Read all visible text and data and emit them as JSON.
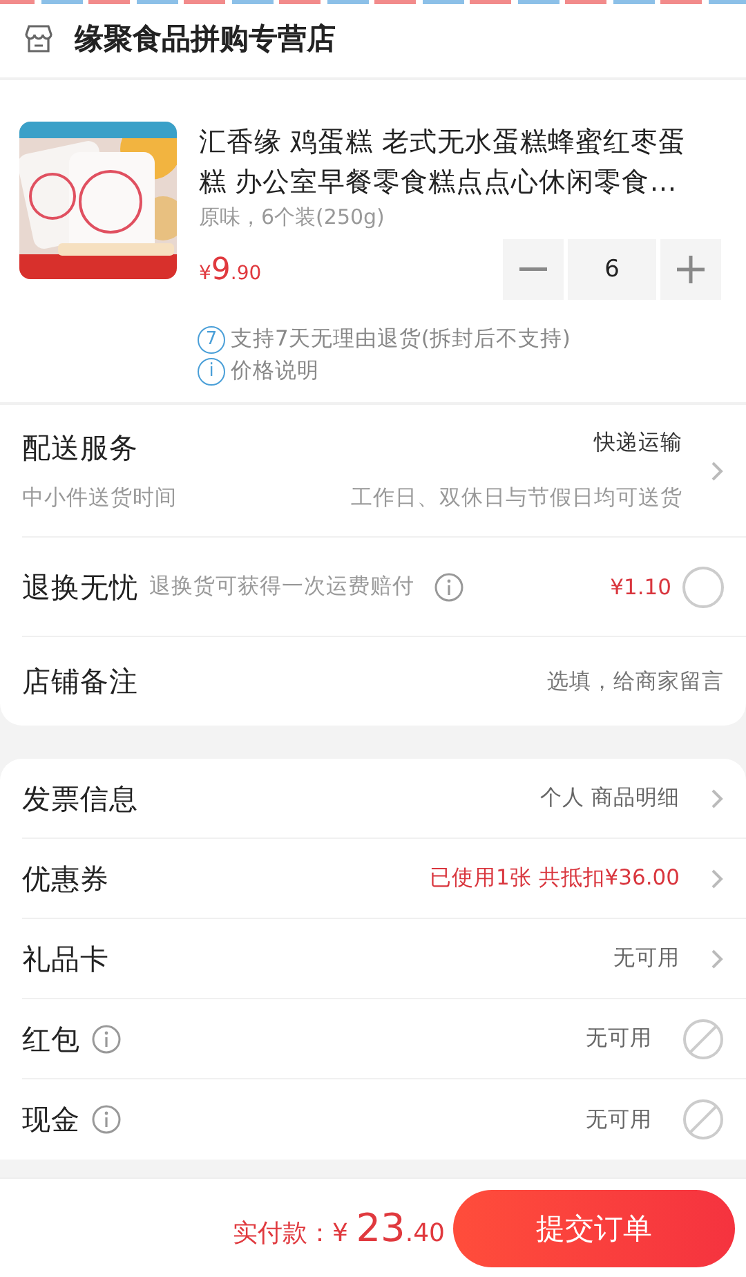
{
  "store": {
    "name": "缘聚食品拼购专营店"
  },
  "product": {
    "title": "汇香缘 鸡蛋糕 老式无水蛋糕蜂蜜红枣蛋糕 办公室早餐零食糕点点心休闲零食…",
    "variant": "原味，6个装(250g)",
    "price": {
      "symbol": "¥",
      "integer": "9",
      "decimal": ".90"
    },
    "quantity": "6",
    "notes": [
      {
        "badge": "7",
        "text": "支持7天无理由退货(拆封后不支持)"
      },
      {
        "badge": "i",
        "text": "价格说明"
      }
    ]
  },
  "delivery": {
    "label": "配送服务",
    "value": "快递运输",
    "sublabel": "中小件送货时间",
    "subvalue": "工作日、双休日与节假日均可送货"
  },
  "return_insurance": {
    "label": "退换无忧",
    "description": "退换货可获得一次运费赔付",
    "price": "¥1.10",
    "selected": false
  },
  "store_note": {
    "label": "店铺备注",
    "placeholder": "选填，给商家留言"
  },
  "options": [
    {
      "kind": "link",
      "label": "发票信息",
      "value": "个人 商品明细",
      "highlight": false,
      "info": false
    },
    {
      "kind": "link",
      "label": "优惠券",
      "value": "已使用1张 共抵扣¥36.00",
      "highlight": true,
      "info": false
    },
    {
      "kind": "link",
      "label": "礼品卡",
      "value": "无可用",
      "highlight": false,
      "info": false
    },
    {
      "kind": "unavailable",
      "label": "红包",
      "value": "无可用",
      "highlight": false,
      "info": true
    },
    {
      "kind": "unavailable",
      "label": "现金",
      "value": "无可用",
      "highlight": false,
      "info": true
    }
  ],
  "footer": {
    "label": "实付款：",
    "symbol": "¥",
    "integer": "23",
    "decimal": ".40",
    "submit": "提交订单"
  }
}
